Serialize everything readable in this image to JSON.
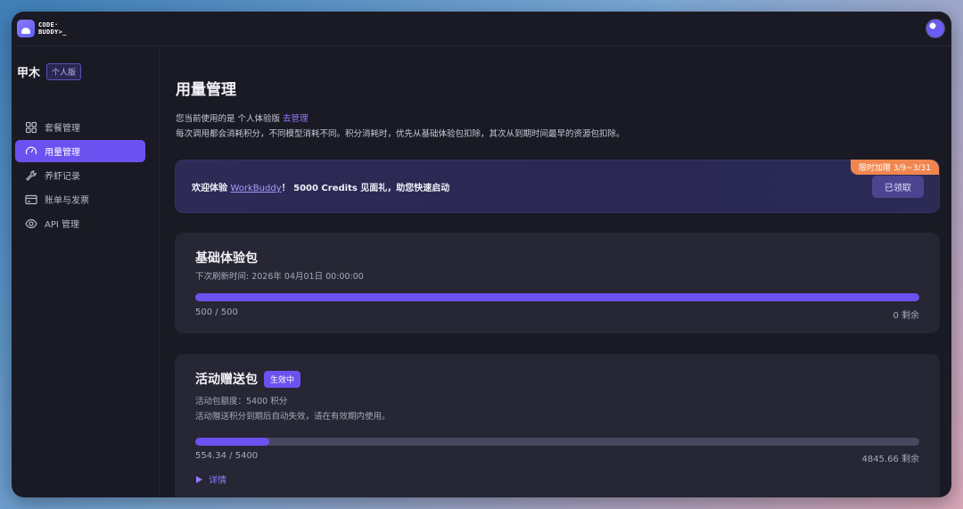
{
  "logo": {
    "line1": "CODE·",
    "line2": "BUDDY>_"
  },
  "sidebar": {
    "user_name": "甲木",
    "plan_badge": "个人版",
    "items": [
      {
        "label": "套餐管理",
        "icon": "grid-icon"
      },
      {
        "label": "用量管理",
        "icon": "gauge-icon",
        "active": true
      },
      {
        "label": "养虾记录",
        "icon": "wrench-icon"
      },
      {
        "label": "账单与发票",
        "icon": "card-icon"
      },
      {
        "label": "API 管理",
        "icon": "eye-icon"
      }
    ]
  },
  "main": {
    "title": "用量管理",
    "desc_line1_prefix": "您当前使用的是 个人体验版 ",
    "desc_link": "去管理",
    "desc_line2": "每次调用都会消耗积分，不同模型消耗不同。积分消耗时，优先从基础体验包扣除，其次从到期时间最早的资源包扣除。"
  },
  "promo": {
    "prefix": "欢迎体验 ",
    "link": "WorkBuddy",
    "suffix": "！ 5000 Credits 见面礼，助您快速启动",
    "button": "已领取",
    "tag": "限时加赠 3/9~3/31"
  },
  "card_basic": {
    "title": "基础体验包",
    "subtitle": "下次刷新时间: 2026年 04月01日 00:00:00",
    "used_text": "500 / 500",
    "remaining_text": "0 剩余",
    "progress": 1.0
  },
  "card_event": {
    "title": "活动赠送包",
    "badge": "生效中",
    "line1": "活动包额度：5400 积分",
    "line2": "活动赠送积分到期后自动失效，请在有效期内使用。",
    "used_text": "554.34 / 5400",
    "remaining_text": "4845.66 剩余",
    "progress": 0.1027,
    "details": "详情"
  },
  "colors": {
    "accent": "#6b52f0",
    "tag": "#f0864f"
  }
}
